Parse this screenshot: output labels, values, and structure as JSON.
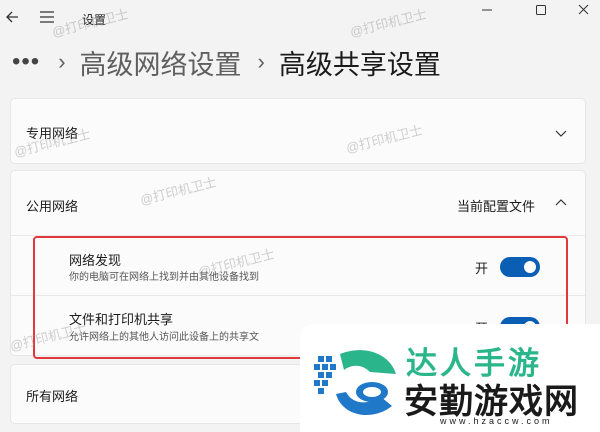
{
  "window": {
    "title": "设置",
    "controls": {
      "minimize_icon": "minimize-icon",
      "maximize_icon": "maximize-icon",
      "close_icon": "close-icon"
    }
  },
  "breadcrumb": {
    "more": "•••",
    "items": [
      "高级网络设置",
      "高级共享设置"
    ]
  },
  "sections": {
    "private": {
      "label": "专用网络",
      "expanded": false
    },
    "public": {
      "label": "公用网络",
      "status": "当前配置文件",
      "expanded": true,
      "settings": [
        {
          "title": "网络发现",
          "description": "你的电脑可在网络上找到并由其他设备找到",
          "state_label": "开",
          "on": true
        },
        {
          "title": "文件和打印机共享",
          "description": "允许网络上的其他人访问此设备上的共享文",
          "state_label": "开",
          "on": true
        }
      ]
    },
    "all": {
      "label": "所有网络"
    }
  },
  "watermark": "@打印机卫士",
  "overlay_logo": {
    "top_text": "达人手游",
    "main_text": "安勤游戏网",
    "url": "www.hzaccw.com"
  },
  "colors": {
    "accent": "#0a5fb4",
    "highlight": "#e0383c",
    "logo_green": "#2bb58a"
  }
}
